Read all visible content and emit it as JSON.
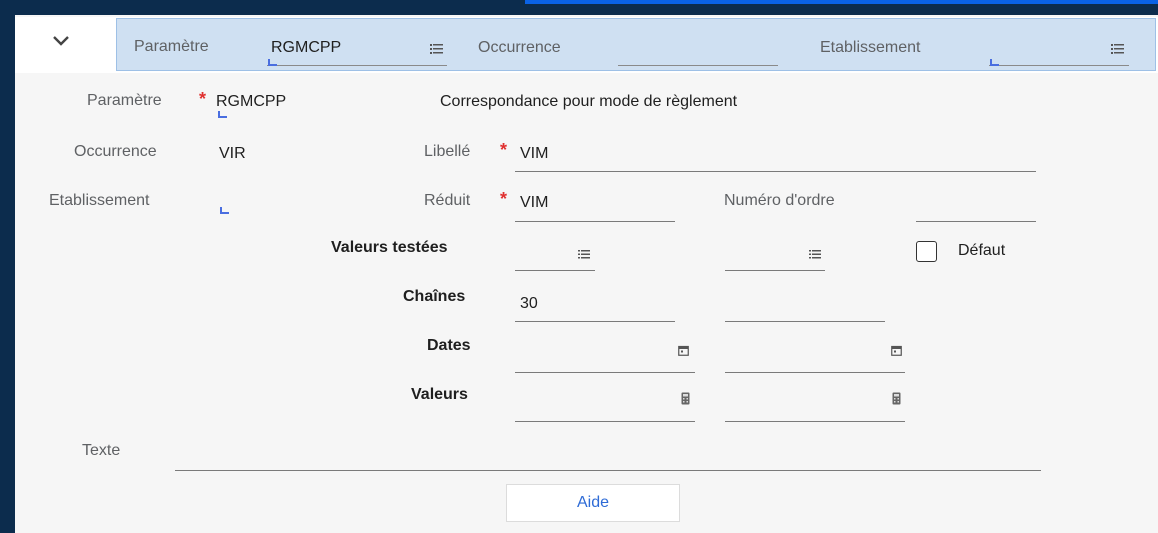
{
  "criteria": {
    "param_label": "Paramètre",
    "param_value": "RGMCPP",
    "occurrence_label": "Occurrence",
    "occurrence_value": "",
    "etablissement_label": "Etablissement",
    "etablissement_value": ""
  },
  "form": {
    "param_label": "Paramètre",
    "param_value": "RGMCPP",
    "param_description": "Correspondance pour mode de règlement",
    "occurrence_label": "Occurrence",
    "occurrence_value": "VIR",
    "libelle_label": "Libellé",
    "libelle_value": "VIM",
    "etablissement_label": "Etablissement",
    "reduit_label": "Réduit",
    "reduit_value": "VIM",
    "numero_label": "Numéro d'ordre",
    "numero_value": "",
    "valeurs_testees_label": "Valeurs testées",
    "defaut_label": "Défaut",
    "defaut_checked": false,
    "chaines_label": "Chaînes",
    "chaines_value_1": "30",
    "chaines_value_2": "",
    "dates_label": "Dates",
    "valeurs_label": "Valeurs",
    "texte_label": "Texte",
    "texte_value": "",
    "aide_label": "Aide"
  },
  "icons": {
    "collapse": "chevron-down-icon",
    "list": "list-icon",
    "calendar": "calendar-icon",
    "calculator": "calculator-icon",
    "lookup": "lookup-corner-icon"
  },
  "colors": {
    "background": "#0c2c4d",
    "accent_stripe": "#0a62e6",
    "criteria_bar": "#cfe0f2",
    "required_star": "#e0302f",
    "link": "#2e6bd6"
  }
}
